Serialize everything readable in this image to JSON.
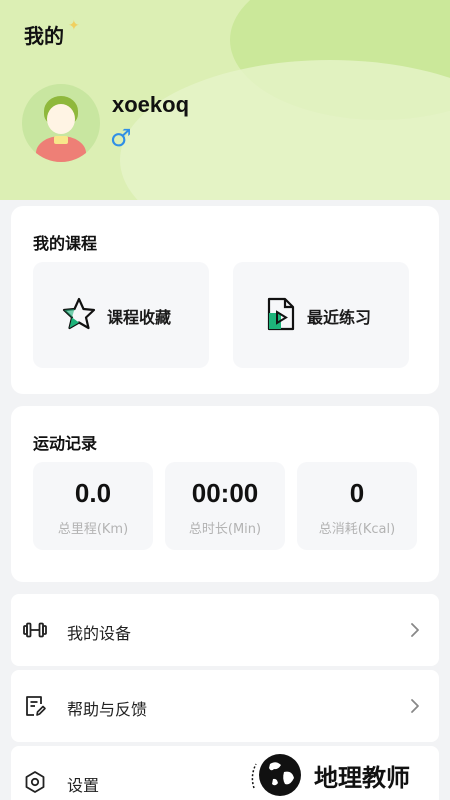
{
  "header": {
    "title": "我的",
    "username": "xoekoq",
    "gender_symbol": "♂"
  },
  "courses": {
    "title": "我的课程",
    "items": [
      {
        "label": "课程收藏",
        "icon": "star-icon"
      },
      {
        "label": "最近练习",
        "icon": "practice-file-icon"
      }
    ]
  },
  "records": {
    "title": "运动记录",
    "stats": [
      {
        "value": "0.0",
        "label": "总里程(Km)"
      },
      {
        "value": "00:00",
        "label": "总时长(Min)"
      },
      {
        "value": "0",
        "label": "总消耗(Kcal)"
      }
    ]
  },
  "menu": [
    {
      "label": "我的设备",
      "icon": "dumbbell-icon"
    },
    {
      "label": "帮助与反馈",
      "icon": "feedback-icon"
    },
    {
      "label": "设置",
      "icon": "settings-icon"
    }
  ],
  "watermark": {
    "text": "地理教师"
  },
  "colors": {
    "accent": "#1db37a",
    "header_bg": "#dcefb4",
    "gender": "#2f8fe6"
  }
}
